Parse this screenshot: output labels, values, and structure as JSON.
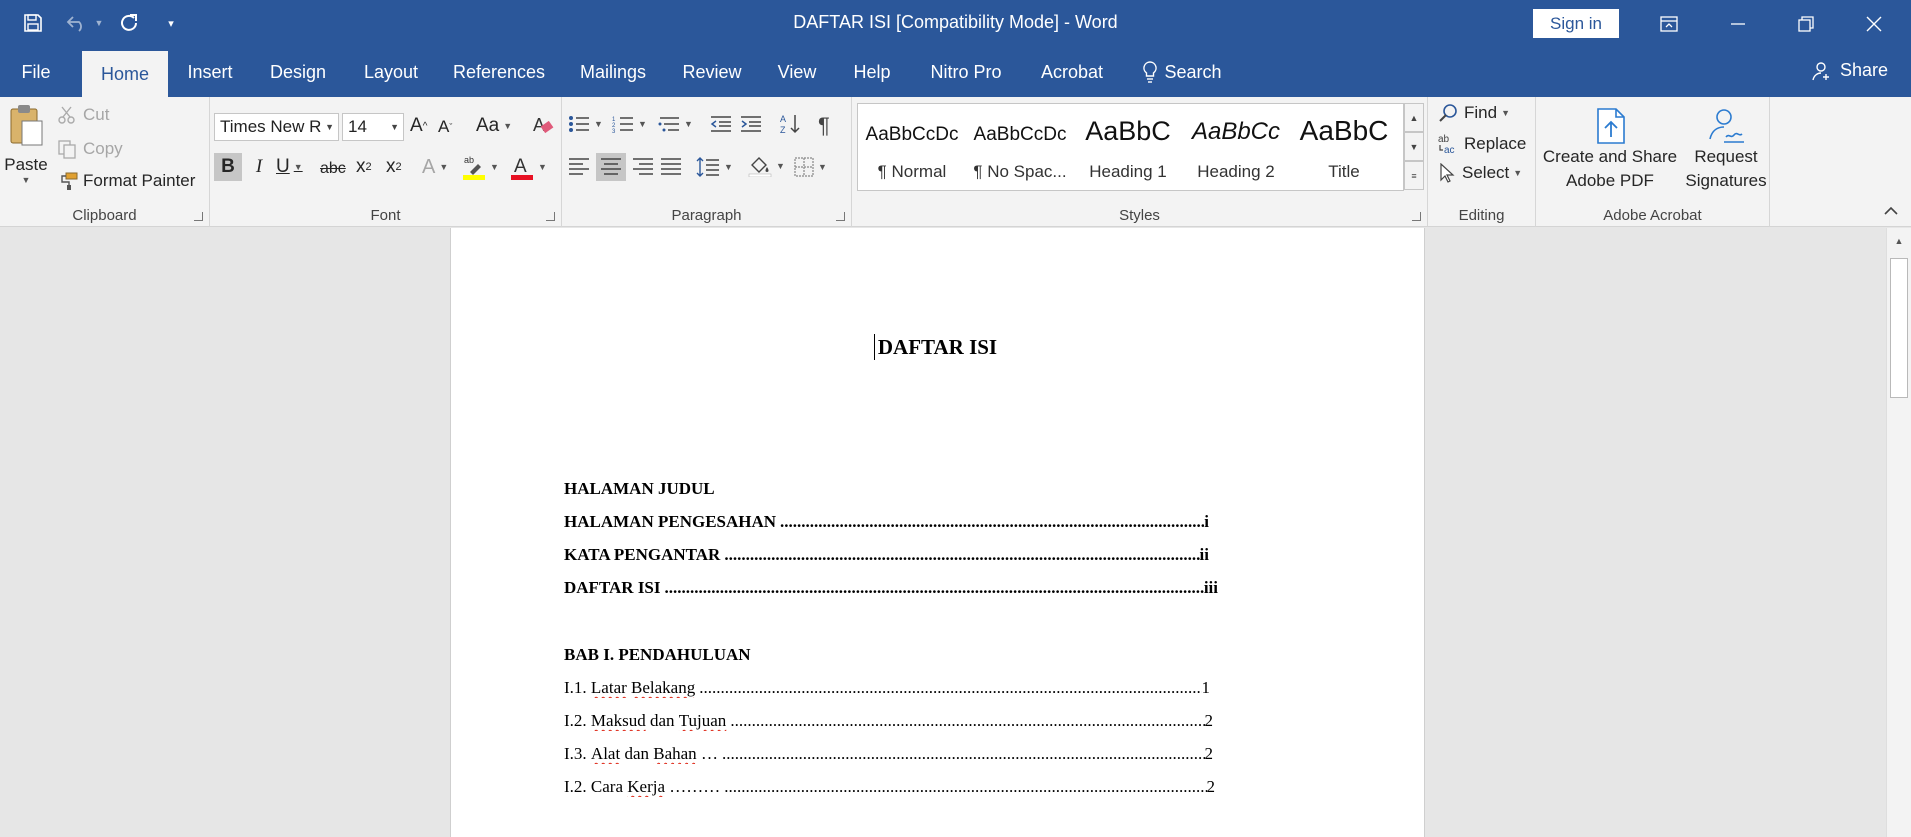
{
  "window": {
    "title": "DAFTAR ISI [Compatibility Mode]  -  Word",
    "sign_in": "Sign in"
  },
  "tabs": [
    "File",
    "Home",
    "Insert",
    "Design",
    "Layout",
    "References",
    "Mailings",
    "Review",
    "View",
    "Help",
    "Nitro Pro",
    "Acrobat",
    "Search"
  ],
  "active_tab": "Home",
  "share_label": "Share",
  "ribbon": {
    "clipboard": {
      "paste": "Paste",
      "cut": "Cut",
      "copy": "Copy",
      "format_painter": "Format Painter",
      "label": "Clipboard"
    },
    "font": {
      "name": "Times New R",
      "size": "14",
      "label": "Font"
    },
    "paragraph": {
      "label": "Paragraph"
    },
    "styles": {
      "label": "Styles",
      "items": [
        {
          "preview": "AaBbCcDc",
          "name": "¶ Normal"
        },
        {
          "preview": "AaBbCcDc",
          "name": "¶ No Spac..."
        },
        {
          "preview": "AaBbC",
          "name": "Heading 1"
        },
        {
          "preview": "AaBbCc",
          "name": "Heading 2"
        },
        {
          "preview": "AaBbC",
          "name": "Title"
        }
      ]
    },
    "editing": {
      "find": "Find",
      "replace": "Replace",
      "select": "Select",
      "label": "Editing"
    },
    "acrobat": {
      "create_line1": "Create and Share",
      "create_line2": "Adobe PDF",
      "request_line1": "Request",
      "request_line2": "Signatures",
      "label": "Adobe Acrobat"
    }
  },
  "document": {
    "title": "DAFTAR ISI",
    "entries": [
      {
        "text": "HALAMAN JUDUL",
        "page": ""
      },
      {
        "text": "HALAMAN PENGESAHAN",
        "page": "i"
      },
      {
        "text": "KATA PENGANTAR",
        "page": "ii"
      },
      {
        "text": "DAFTAR ISI",
        "page": "iii"
      },
      {
        "text": "BAB I. PENDAHULUAN",
        "page": ""
      },
      {
        "prefix": "I.1. ",
        "w1": "Latar",
        "mid": " ",
        "w2": "Belakang",
        "suffix": "",
        "page": "1"
      },
      {
        "prefix": "I.2. ",
        "w1": "Maksud",
        "mid": " dan ",
        "w2": "Tujuan",
        "suffix": "",
        "page": "2"
      },
      {
        "prefix": "I.3. ",
        "w1": "Alat",
        "mid": " dan ",
        "w2": "Bahan",
        "suffix": " …",
        "page": "2"
      },
      {
        "prefix": "I.2. Cara ",
        "w1": "Kerja",
        "mid": "",
        "w2": "",
        "suffix": " ………",
        "page": "2"
      }
    ]
  }
}
